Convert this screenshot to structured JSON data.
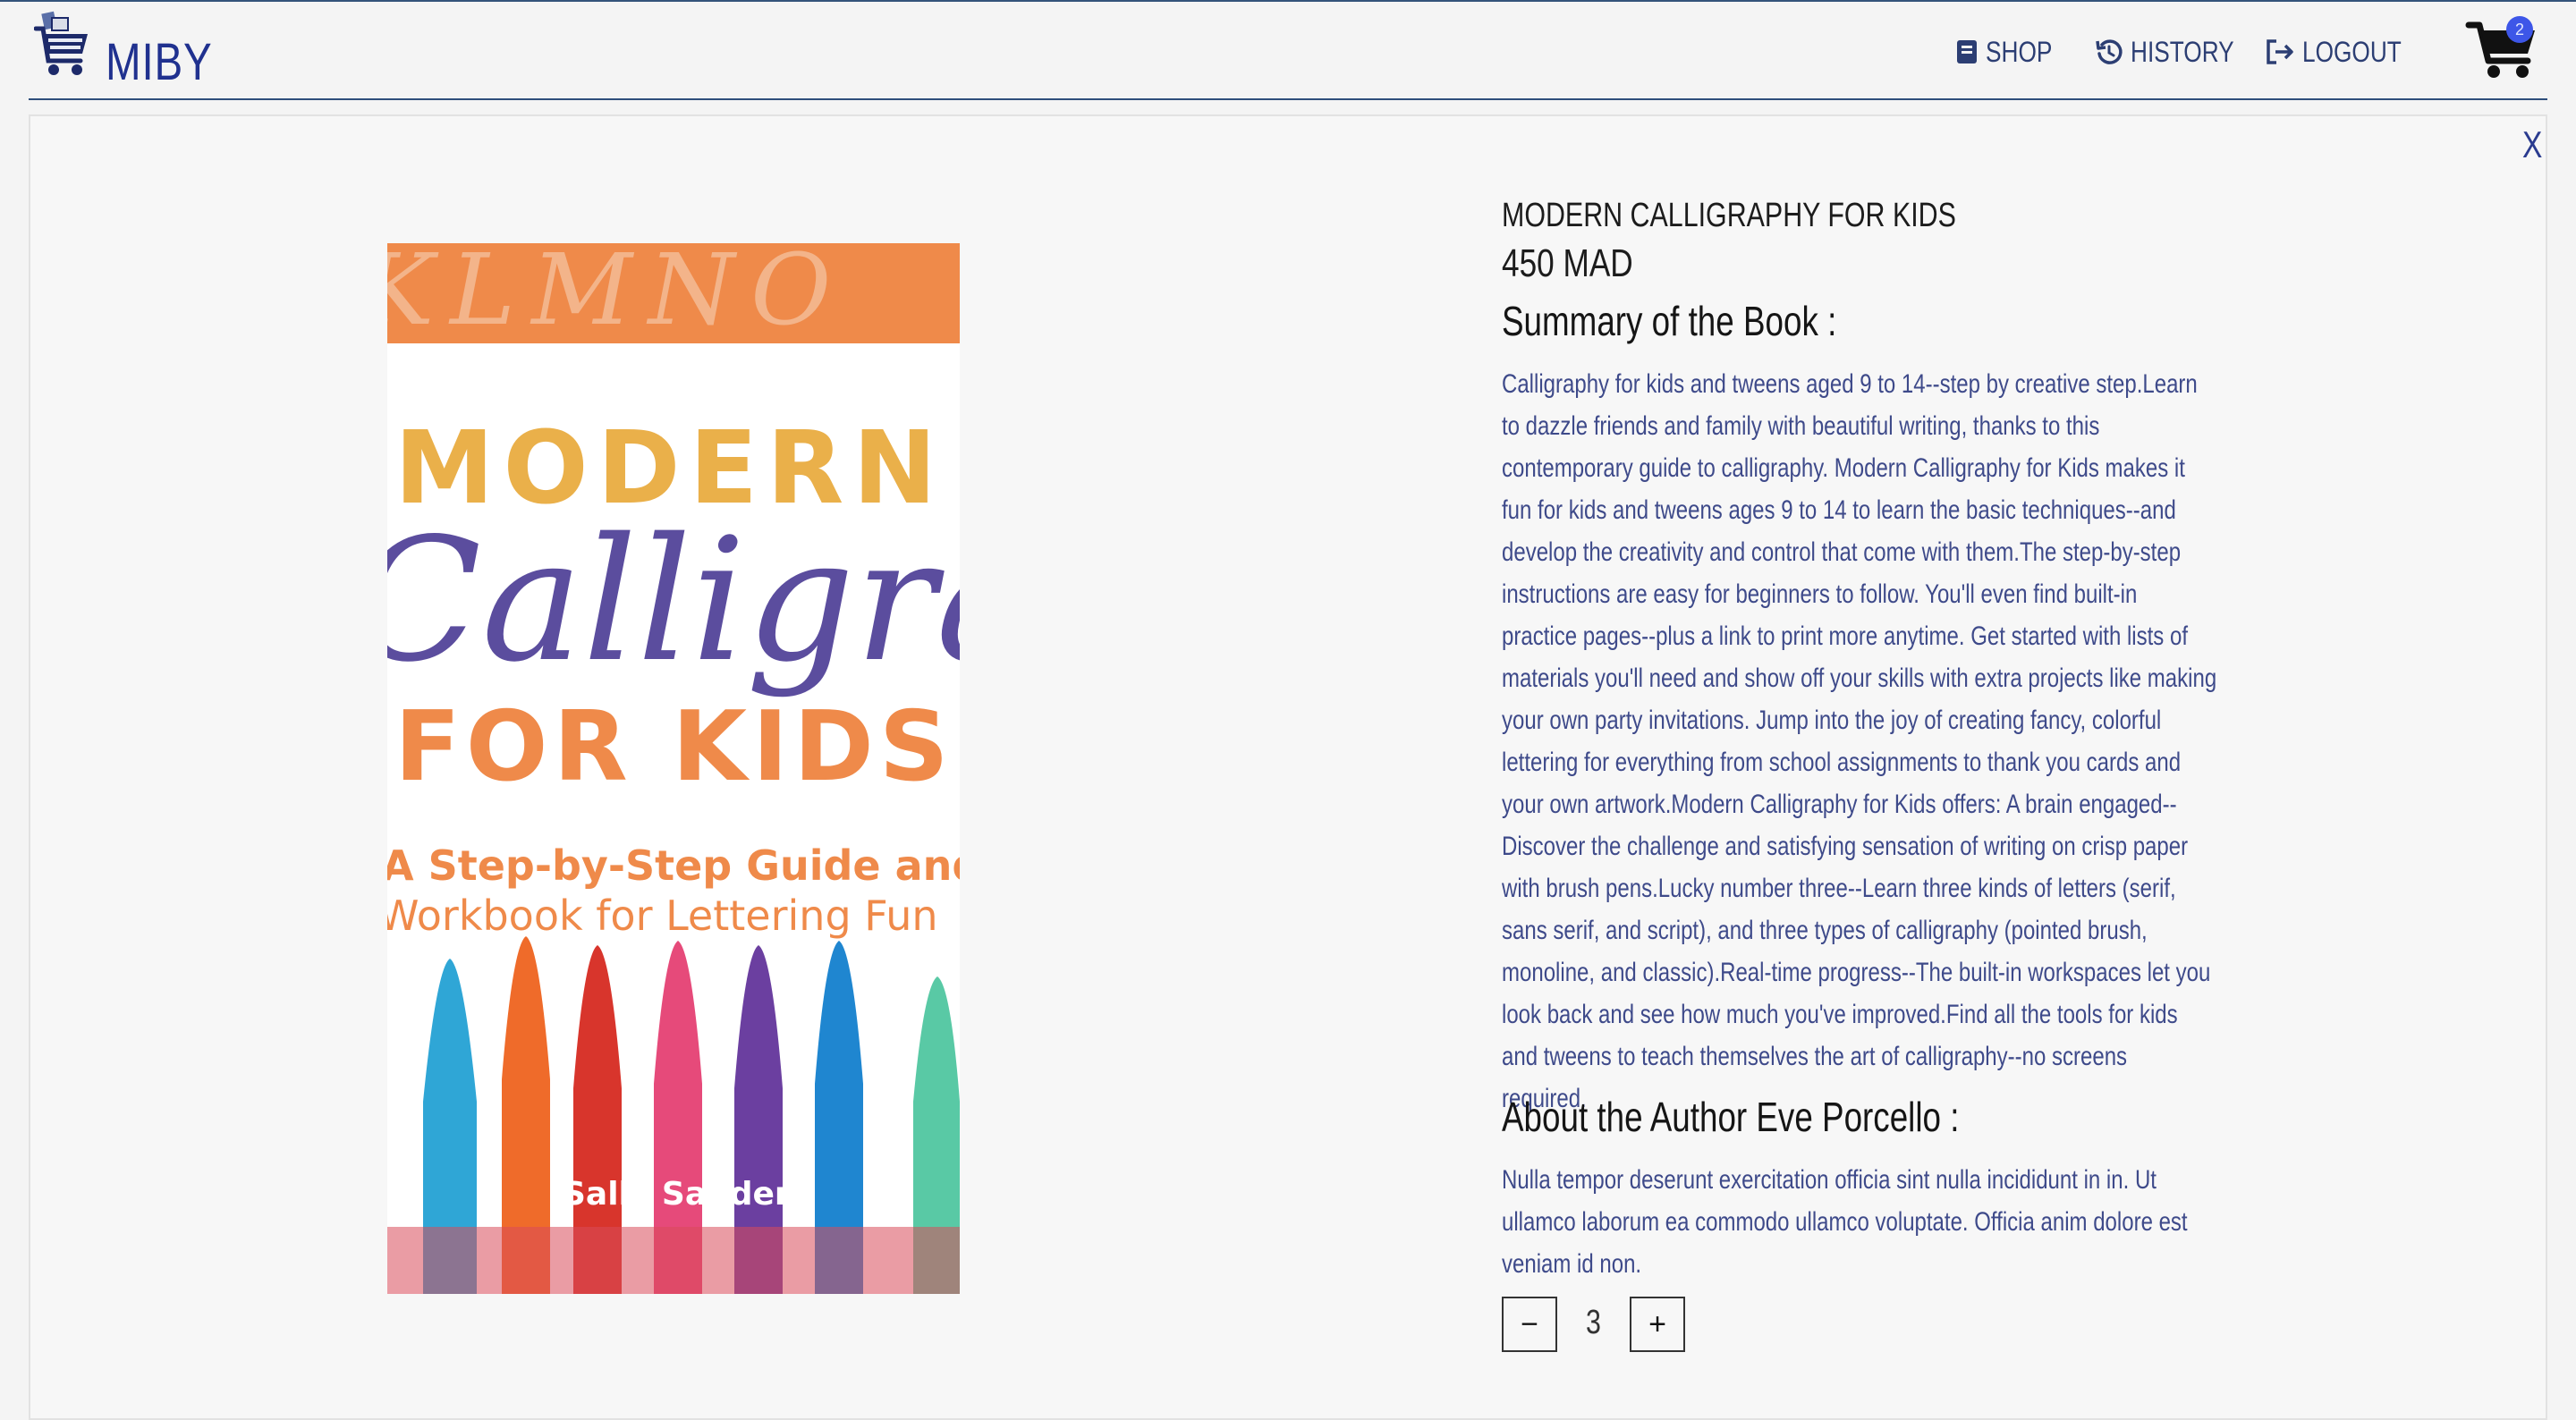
{
  "brand": {
    "name": "MIBY"
  },
  "nav": {
    "shop": "SHOP",
    "history": "HISTORY",
    "logout": "LOGOUT"
  },
  "cart": {
    "count": "2"
  },
  "modal": {
    "close": "X",
    "title": "MODERN CALLIGRAPHY FOR KIDS",
    "price": "450 MAD",
    "summary_heading": "Summary of the Book :",
    "summary": "Calligraphy for kids and tweens aged 9 to 14--step by creative step.Learn to dazzle friends and family with beautiful writing, thanks to this contemporary guide to calligraphy. Modern Calligraphy for Kids makes it fun for kids and tweens ages 9 to 14 to learn the basic techniques--and develop the creativity and control that come with them.The step-by-step instructions are easy for beginners to follow. You'll even find built-in practice pages--plus a link to print more anytime. Get started with lists of materials you'll need and show off your skills with extra projects like making your own party invitations. Jump into the joy of creating fancy, colorful lettering for everything from school assignments to thank you cards and your own artwork.Modern Calligraphy for Kids offers: A brain engaged--Discover the challenge and satisfying sensation of writing on crisp paper with brush pens.Lucky number three--Learn three kinds of letters (serif, sans serif, and script), and three types of calligraphy (pointed brush, monoline, and classic).Real-time progress--The built-in workspaces let you look back and see how much you've improved.Find all the tools for kids and tweens to teach themselves the art of calligraphy--no screens required.",
    "author_heading": "About the Author Eve Porcello :",
    "author_bio": "Nulla tempor deserunt exercitation officia sint nulla incididunt in in. Ut ullamco laborum ea commodo ullamco voluptate. Officia anim dolore est veniam id non.",
    "quantity": "3",
    "minus": "−",
    "plus": "+"
  },
  "cover": {
    "banner_letters": "KLMNO",
    "line1": "MODERN",
    "line2": "Calligraphy",
    "line3": "FOR KIDS",
    "subtitle1": "A Step-by-Step Guide and",
    "subtitle2": "Workbook for Lettering Fun",
    "author": "Sally Sanders"
  },
  "colors": {
    "brand": "#20318f",
    "nav": "#2c3e73",
    "badge": "#3d56e8",
    "body_text": "#3e4a8a",
    "cover_orange": "#ef8a4a",
    "cover_yellow": "#eab04a",
    "cover_purple": "#5b4d9e"
  }
}
